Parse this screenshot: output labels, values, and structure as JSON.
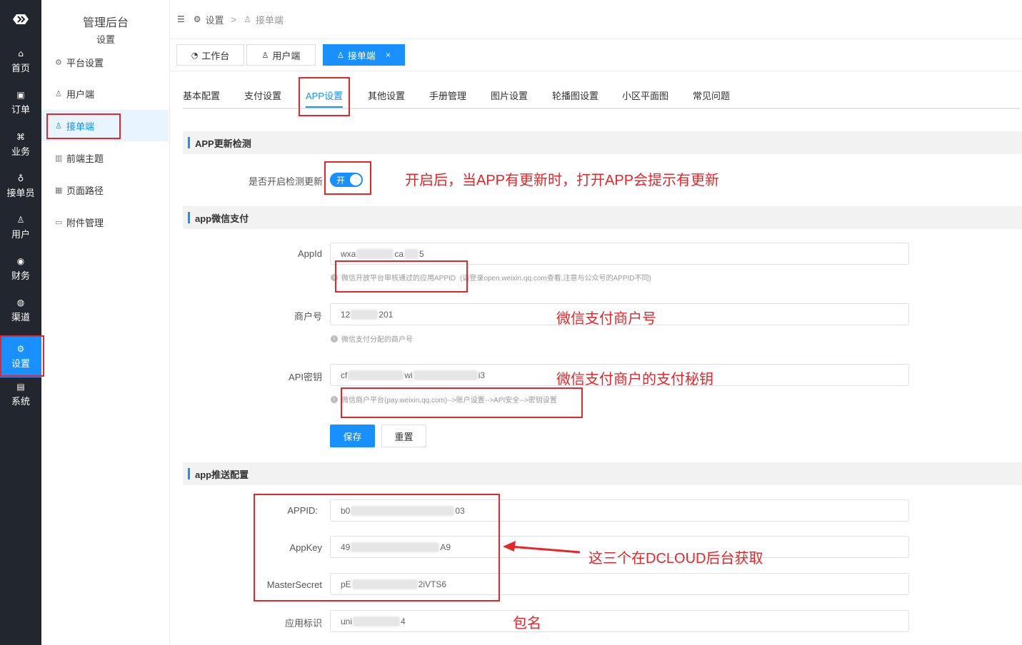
{
  "sidebar": {
    "items": [
      {
        "label": "首页",
        "icon": "home-icon",
        "glyph": "⌂"
      },
      {
        "label": "订单",
        "icon": "order-icon",
        "glyph": "▣"
      },
      {
        "label": "业务",
        "icon": "business-icon",
        "glyph": "⌘"
      },
      {
        "label": "接单员",
        "icon": "bicycle-icon",
        "glyph": "♁"
      },
      {
        "label": "用户",
        "icon": "user-icon",
        "glyph": "♙"
      },
      {
        "label": "财务",
        "icon": "finance-icon",
        "glyph": "◉"
      },
      {
        "label": "渠道",
        "icon": "channel-icon",
        "glyph": "◍"
      },
      {
        "label": "设置",
        "icon": "settings-icon",
        "glyph": "⚙"
      },
      {
        "label": "系统",
        "icon": "system-icon",
        "glyph": "▤"
      }
    ],
    "active_label": "设置"
  },
  "submenu": {
    "title": "管理后台",
    "subtitle": "设置",
    "items": [
      {
        "label": "平台设置",
        "glyph": "⚙"
      },
      {
        "label": "用户端",
        "glyph": "♙"
      },
      {
        "label": "接单端",
        "glyph": "♙"
      },
      {
        "label": "前端主题",
        "glyph": "▥"
      },
      {
        "label": "页面路径",
        "glyph": "▦"
      },
      {
        "label": "附件管理",
        "glyph": "▭"
      }
    ],
    "active_label": "接单端"
  },
  "breadcrumb": {
    "items": [
      "设置",
      "接单端"
    ],
    "separator": ">"
  },
  "tags": [
    {
      "label": "工作台"
    },
    {
      "label": "用户端"
    },
    {
      "label": "接单端",
      "close": "×"
    }
  ],
  "tabs": {
    "items": [
      "基本配置",
      "支付设置",
      "APP设置",
      "其他设置",
      "手册管理",
      "图片设置",
      "轮播图设置",
      "小区平面图",
      "常见问题"
    ],
    "active": "APP设置"
  },
  "sections": {
    "update": {
      "title": "APP更新检测",
      "switch_label": "是否开启检测更新",
      "switch_text": "开",
      "switch_on": true
    },
    "wechat_pay": {
      "title": "app微信支付",
      "appid_label": "AppId",
      "appid_prefix": "wxa",
      "appid_mid": "ca",
      "appid_suffix": "5",
      "appid_hint_main": "微信开放平台审核通过的应用APPID",
      "appid_hint_rest": "(请登录open.weixin.qq.com查看,注意与公众号的APPID不同)",
      "mch_label": "商户号",
      "mch_prefix": "12",
      "mch_suffix": "201",
      "mch_hint": "微信支付分配的商户号",
      "key_label": "API密钥",
      "key_prefix": "cf",
      "key_mid": "wi",
      "key_suffix": "i3",
      "key_hint": "微信商户平台(pay.weixin.qq.com)-->账户设置-->API安全-->密钥设置",
      "save": "保存",
      "reset": "重置"
    },
    "push": {
      "title": "app推送配置",
      "appid_label": "APPID:",
      "appid_prefix": "b0",
      "appid_suffix": "03",
      "appkey_label": "AppKey",
      "appkey_prefix": "49",
      "appkey_suffix": "A9",
      "master_label": "MasterSecret",
      "master_prefix": "pE",
      "master_suffix": "2iVTS6",
      "bundle_label": "应用标识",
      "bundle_prefix": "uni",
      "bundle_suffix": "4"
    }
  },
  "annotations": {
    "switch_note": "开启后，当APP有更新时，打开APP会提示有更新",
    "mch_note": "微信支付商户号",
    "key_note": "微信支付商户的支付秘钥",
    "push_note": "这三个在DCLOUD后台获取",
    "bundle_note": "包名",
    "color": "#e8262a"
  },
  "colors": {
    "accent": "#1890ff",
    "rail": "#22262e"
  }
}
